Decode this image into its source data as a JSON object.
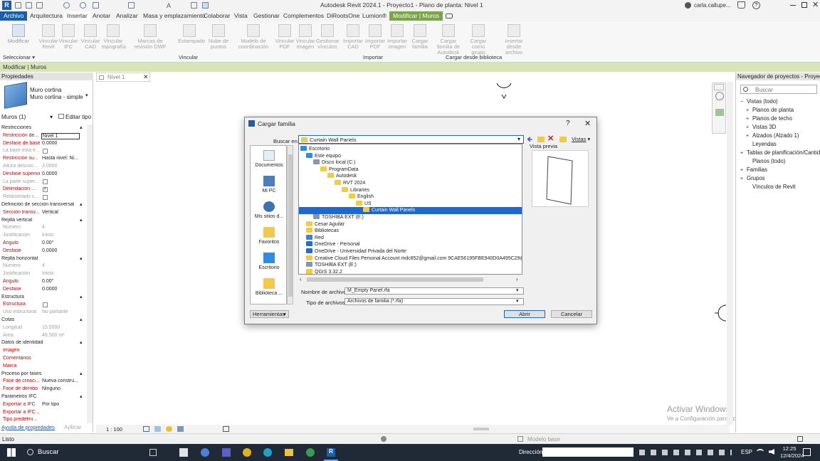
{
  "app": {
    "title": "Autodesk Revit 2024.1 - Proyecto1 - Plano de planta: Nivel 1",
    "user": "carla.callupe..."
  },
  "ribbon": {
    "tabs": [
      "Archivo",
      "Arquitectura",
      "Insertar",
      "Anotar",
      "Analizar",
      "Masa y emplazamiento",
      "Colaborar",
      "Vista",
      "Gestionar",
      "Complementos",
      "DiRootsOne",
      "Lumion®",
      "Modificar | Muros"
    ],
    "buttons": [
      "Modificar",
      "Vincular Revit",
      "Vincular IFC",
      "Vincular CAD",
      "Vincular topografía",
      "Marcas de revisión DWF",
      "Estampado",
      "Nube de puntos",
      "Modelo de coordinación",
      "Vincular PDF",
      "Vincular imagen",
      "Gestionar vínculos",
      "Importar CAD",
      "Importar PDF",
      "Importar imagen",
      "Cargar familia",
      "Cargar familia de Autodesk",
      "Cargar como grupo",
      "Insertar desde archivo"
    ],
    "panels": [
      "Seleccionar ▾",
      "Vincular",
      "Importar",
      "Cargar desde biblioteca"
    ]
  },
  "context_bar": "Modificar | Muros",
  "properties": {
    "title": "Propiedades",
    "type_name": "Muro cortina",
    "type_sub": "Muro cortina - simple",
    "filter": "Muros (1)",
    "edit_type": "Editar tipo",
    "rows": [
      {
        "k": "Restricciones",
        "v": "",
        "type": "sec"
      },
      {
        "k": "Restricción de...",
        "v": "Nivel 1",
        "type": "hl"
      },
      {
        "k": "Desfase de base",
        "v": "0.0000",
        "type": "hl"
      },
      {
        "k": "La base está e...",
        "v": "",
        "type": "dimcb"
      },
      {
        "k": "Restricción su...",
        "v": "Hasta nivel: Ni...",
        "type": "hl"
      },
      {
        "k": "Altura descon...",
        "v": "3.0000",
        "type": "dim"
      },
      {
        "k": "Desfase superior",
        "v": "0.0000",
        "type": "hl"
      },
      {
        "k": "La parte super...",
        "v": "",
        "type": "dimcb"
      },
      {
        "k": "Delimitación ...",
        "v": "",
        "type": "hlcb"
      },
      {
        "k": "Relacionado c...",
        "v": "",
        "type": "dimcb"
      },
      {
        "k": "Definición de sección transversal",
        "v": "",
        "type": "sec"
      },
      {
        "k": "Sección transv...",
        "v": "Vertical",
        "type": "hl"
      },
      {
        "k": "Rejilla vertical",
        "v": "",
        "type": "sec"
      },
      {
        "k": "Número",
        "v": "4",
        "type": "dim"
      },
      {
        "k": "Justificación",
        "v": "Inicio",
        "type": "dim"
      },
      {
        "k": "Ángulo",
        "v": "0.00°",
        "type": "hl"
      },
      {
        "k": "Desfase",
        "v": "0.0000",
        "type": "hl"
      },
      {
        "k": "Rejilla horizontal",
        "v": "",
        "type": "sec"
      },
      {
        "k": "Número",
        "v": "4",
        "type": "dim"
      },
      {
        "k": "Justificación",
        "v": "Inicio",
        "type": "dim"
      },
      {
        "k": "Ángulo",
        "v": "0.00°",
        "type": "hl"
      },
      {
        "k": "Desfase",
        "v": "0.0000",
        "type": "hl"
      },
      {
        "k": "Estructura",
        "v": "",
        "type": "sec"
      },
      {
        "k": "Estructura",
        "v": "",
        "type": "hlcb"
      },
      {
        "k": "Uso estructural",
        "v": "No portante",
        "type": "dim"
      },
      {
        "k": "Cotas",
        "v": "",
        "type": "sec"
      },
      {
        "k": "Longitud",
        "v": "15.5000",
        "type": "dim"
      },
      {
        "k": "Área",
        "v": "46.500 m²",
        "type": "dim"
      },
      {
        "k": "Datos de identidad",
        "v": "",
        "type": "sec"
      },
      {
        "k": "Imagen",
        "v": "",
        "type": "hl"
      },
      {
        "k": "Comentarios",
        "v": "",
        "type": "hl"
      },
      {
        "k": "Marca",
        "v": "",
        "type": "hl"
      },
      {
        "k": "Proceso por fases",
        "v": "",
        "type": "sec"
      },
      {
        "k": "Fase de creaci...",
        "v": "Nueva constru...",
        "type": "hl"
      },
      {
        "k": "Fase de derribo",
        "v": "Ninguno",
        "type": "hl"
      },
      {
        "k": "Parámetros IFC",
        "v": "",
        "type": "sec"
      },
      {
        "k": "Exportar a IFC",
        "v": "Por tipo",
        "type": "hl"
      },
      {
        "k": "Exportar a IFC ...",
        "v": "",
        "type": "hl"
      },
      {
        "k": "Tipo predefini...",
        "v": "",
        "type": "hl"
      }
    ],
    "help_link": "Ayuda de propiedades",
    "apply": "Aplicar"
  },
  "view": {
    "tab": "Nivel 1",
    "scale": "1 : 100"
  },
  "watermark": {
    "line1": "Activar Windows",
    "line2": "Ve a Configuración para activar Windows."
  },
  "browser": {
    "title": "Navegador de proyectos - Proyect...",
    "search": "Buscar",
    "items": [
      "Vistas (todo)",
      "Planos de planta",
      "Planos de techo",
      "Vistas 3D",
      "Alzados (Alzado 1)",
      "Leyendas",
      "Tablas de planificación/Cantidades",
      "Planos (todo)",
      "Familias",
      "Grupos",
      "Vínculos de Revit"
    ]
  },
  "status": {
    "left": "Listo",
    "model": "Modelo base"
  },
  "taskbar": {
    "search": "Buscar",
    "direccion": "Dirección",
    "lang": "ESP",
    "time": "12:25",
    "date": "12/4/2024"
  },
  "dialog": {
    "title": "Cargar familia",
    "help": "?",
    "buscar_label": "Buscar en:",
    "buscar_value": "Curtain Wall Panels",
    "vistas": "Vistas",
    "preview_label": "Vista previa",
    "places": [
      "Documentos",
      "Mi PC",
      "Mis sitios d...",
      "Favoritos",
      "Escritorio",
      "Biblioteca ..."
    ],
    "tree": [
      "Escritorio",
      "Este equipo",
      "Disco local (C:)",
      "ProgramData",
      "Autodesk",
      "RVT 2024",
      "Libraries",
      "English",
      "US",
      "Curtain Wall Panels",
      "TOSHIBA EXT (E:)",
      "Cesar Aguilar",
      "Bibliotecas",
      "Red",
      "OneDrive - Personal",
      "OneDrive - Universidad Privada del Norte",
      "Creative Cloud Files Personal Account mdc852@gmail.com 9CAE56195FBE940D0A495C29@AdobeID",
      "TOSHIBA EXT (E:)",
      "QGIS 3.32.2"
    ],
    "filename_label": "Nombre de archivo:",
    "filename": "M_Empty Panel.rfa",
    "filetype_label": "Tipo de archivos:",
    "filetype": "Archivos de familia (*.rfa)",
    "tools": "Herramientas",
    "open": "Abrir",
    "cancel": "Cancelar"
  }
}
